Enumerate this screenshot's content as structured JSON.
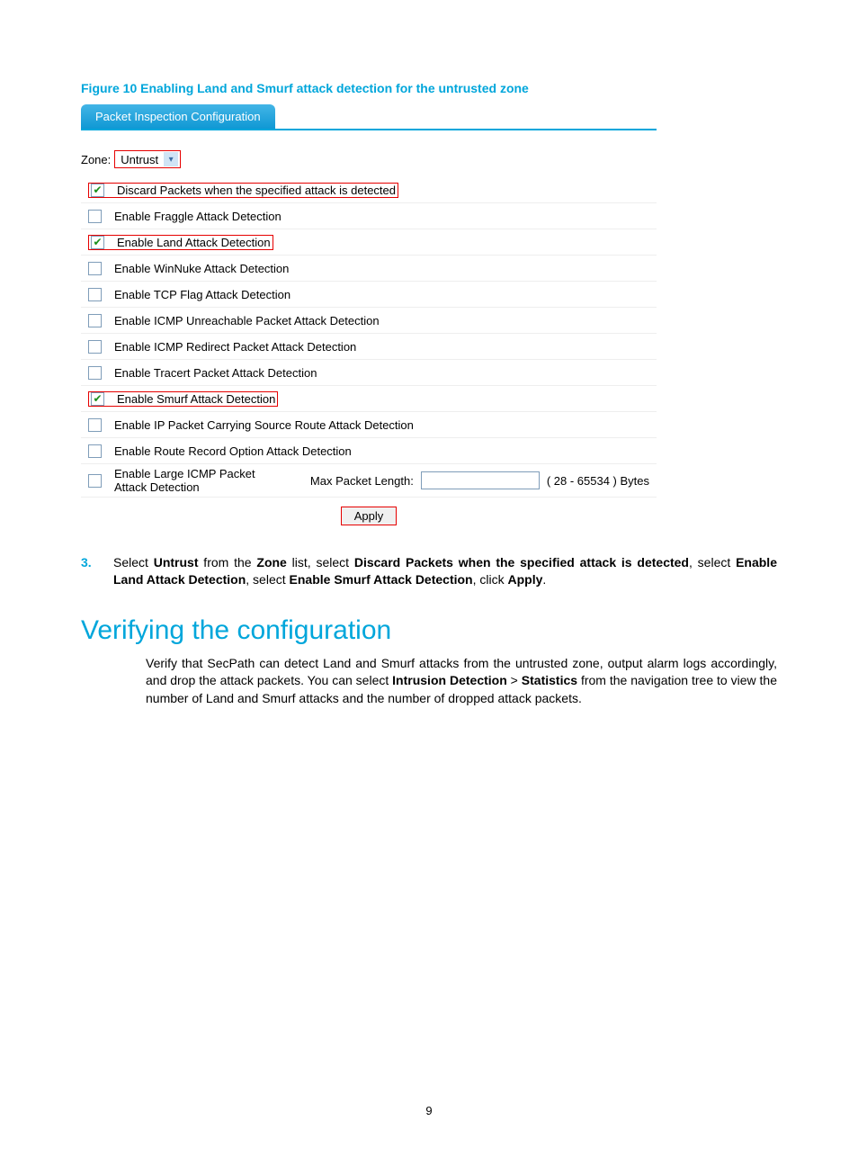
{
  "figure_caption": "Figure 10 Enabling Land and Smurf attack detection for the untrusted zone",
  "tab_title": "Packet Inspection Configuration",
  "zone_label": "Zone:",
  "zone_value": "Untrust",
  "options": [
    {
      "label": "Discard Packets when the specified attack is detected",
      "checked": true,
      "highlight": true
    },
    {
      "label": "Enable Fraggle Attack Detection",
      "checked": false,
      "highlight": false
    },
    {
      "label": "Enable Land Attack Detection",
      "checked": true,
      "highlight": true
    },
    {
      "label": "Enable WinNuke Attack Detection",
      "checked": false,
      "highlight": false
    },
    {
      "label": "Enable TCP Flag Attack Detection",
      "checked": false,
      "highlight": false
    },
    {
      "label": "Enable ICMP Unreachable Packet Attack Detection",
      "checked": false,
      "highlight": false
    },
    {
      "label": "Enable ICMP Redirect Packet Attack Detection",
      "checked": false,
      "highlight": false
    },
    {
      "label": "Enable Tracert Packet Attack Detection",
      "checked": false,
      "highlight": false
    },
    {
      "label": "Enable Smurf Attack Detection",
      "checked": true,
      "highlight": true
    },
    {
      "label": "Enable IP Packet Carrying Source Route Attack Detection",
      "checked": false,
      "highlight": false
    },
    {
      "label": "Enable Route Record Option Attack Detection",
      "checked": false,
      "highlight": false
    }
  ],
  "large_icmp": {
    "label": "Enable Large ICMP Packet Attack Detection",
    "max_label": "Max Packet Length:",
    "range": "( 28 - 65534 ) Bytes"
  },
  "apply_label": "Apply",
  "step_num": "3.",
  "step_parts": {
    "p1": "Select ",
    "b1": "Untrust",
    "p2": " from the ",
    "b2": "Zone",
    "p3": " list, select ",
    "b3": "Discard Packets when the specified attack is detected",
    "p4": ", select ",
    "b4": "Enable Land Attack Detection",
    "p5": ", select ",
    "b5": "Enable Smurf Attack Detection",
    "p6": ", click ",
    "b6": "Apply",
    "p7": "."
  },
  "section_heading": "Verifying the configuration",
  "body": {
    "p1": "Verify that SecPath can detect Land and Smurf attacks from the untrusted zone, output alarm logs accordingly, and drop the attack packets. You can select ",
    "b1": "Intrusion Detection",
    "gt": " > ",
    "b2": "Statistics",
    "p2": " from the navigation tree to view the number of Land and Smurf attacks and the number of dropped attack packets."
  },
  "page_number": "9"
}
